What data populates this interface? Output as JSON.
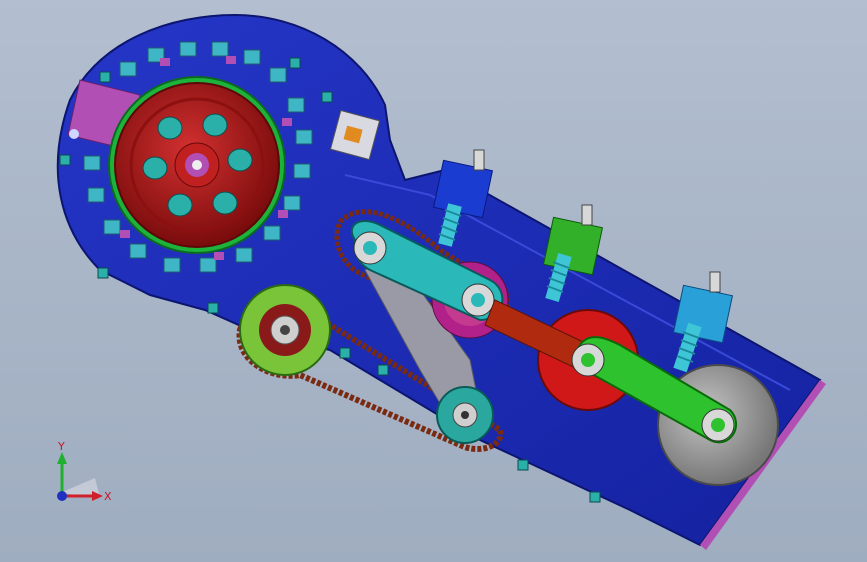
{
  "viewport": {
    "background_top": "#b3bfd1",
    "background_bottom": "#9fadc0",
    "model_colors": {
      "frame": "#1d2bb3",
      "frame_edge": "#0c1570",
      "wheel_red": "#b01818",
      "ring_green": "#1db33a",
      "arm_cyan": "#2ab8b8",
      "arm_green": "#2ec22e",
      "arm_red": "#b02a10",
      "plate_magenta": "#b24fb5",
      "pulley_grey": "#9a9a9a",
      "chain_brown": "#7a2a10",
      "link_grey": "#9a9aa6"
    }
  },
  "triad": {
    "x_label": "X",
    "y_label": "Y",
    "icon": "coordinate-triad-icon",
    "x_color": "#d0202a",
    "y_color": "#20b030",
    "z_color": "#2030c0"
  }
}
